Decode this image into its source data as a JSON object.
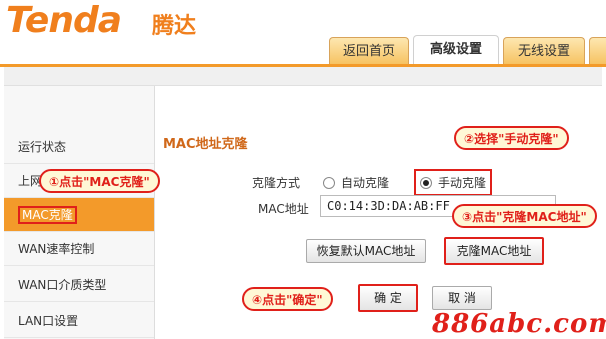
{
  "header": {
    "logo": "Tenda",
    "logo_cn": "腾达",
    "tabs": [
      {
        "label": "返回首页"
      },
      {
        "label": "高级设置",
        "active": true
      },
      {
        "label": "无线设置"
      }
    ]
  },
  "sidebar": {
    "items": [
      {
        "label": "运行状态"
      },
      {
        "label": "上网"
      },
      {
        "label": "MAC克隆",
        "active": true
      },
      {
        "label": "WAN速率控制"
      },
      {
        "label": "WAN口介质类型"
      },
      {
        "label": "LAN口设置"
      }
    ]
  },
  "main": {
    "section_title": "MAC地址克隆",
    "clone_mode_label": "克隆方式",
    "clone_auto": "自动克隆",
    "clone_manual": "手动克隆",
    "mac_label": "MAC地址",
    "mac_value": "C0:14:3D:DA:AB:FF",
    "restore_button": "恢复默认MAC地址",
    "clone_button": "克隆MAC地址",
    "ok_button": "确 定",
    "cancel_button": "取 消"
  },
  "callouts": {
    "step1": "①点击\"MAC克隆\"",
    "step2": "②选择\"手动克隆\"",
    "step3": "③点击\"克隆MAC地址\"",
    "step4": "④点击\"确定\""
  },
  "watermark": "886abc.com",
  "colors": {
    "brand": "#f07f1d",
    "accent": "#f39a2a",
    "callout": "#e0201a"
  }
}
